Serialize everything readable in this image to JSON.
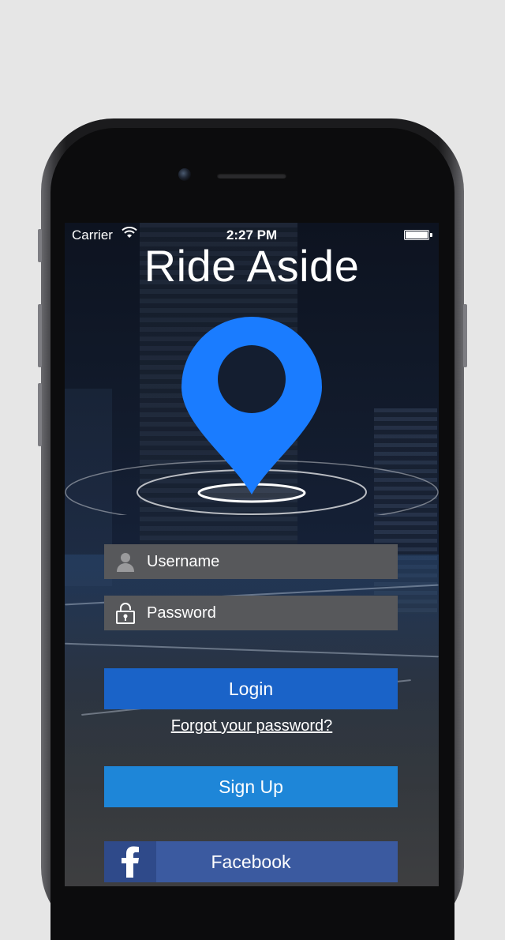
{
  "status_bar": {
    "carrier": "Carrier",
    "time": "2:27 PM"
  },
  "app": {
    "title": "Ride Aside",
    "logo_icon": "map-pin-icon"
  },
  "login_form": {
    "username_placeholder": "Username",
    "password_placeholder": "Password",
    "login_label": "Login",
    "forgot_label": "Forgot your password?",
    "signup_label": "Sign Up",
    "facebook_label": "Facebook",
    "facebook_icon": "facebook-icon"
  },
  "colors": {
    "pin": "#1a7cff",
    "login_button": "#1a63c8",
    "signup_button": "#1e86d8",
    "facebook_button": "#3b5aa0",
    "field_background": "#57585b"
  }
}
